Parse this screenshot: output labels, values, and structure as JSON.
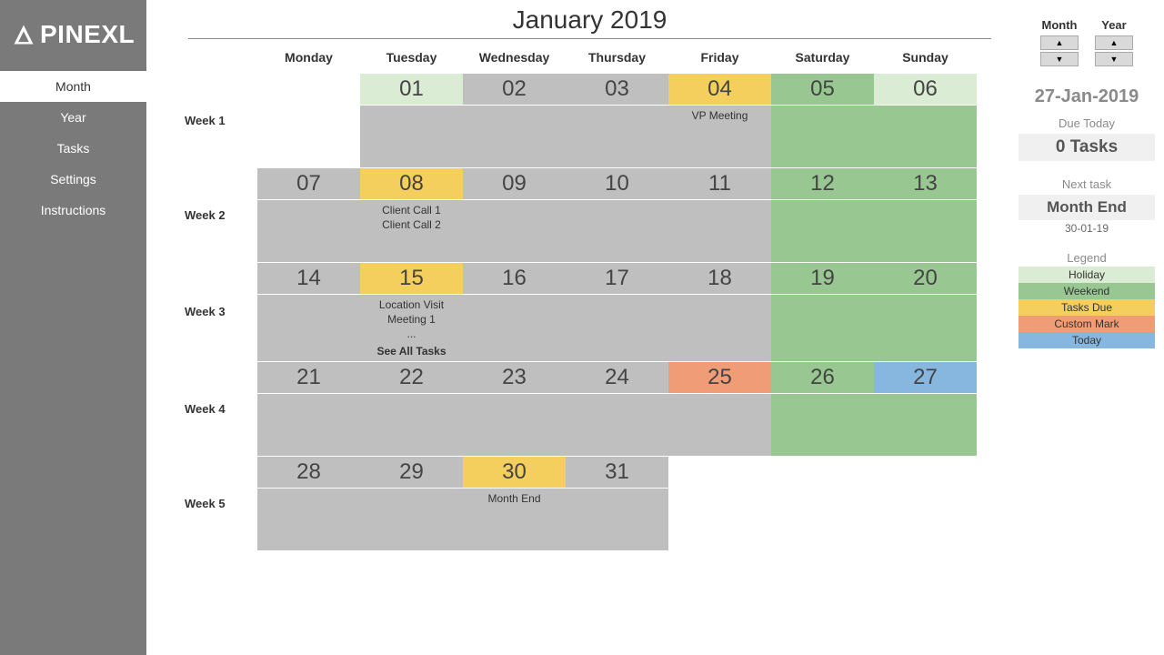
{
  "brand": "PINEXL",
  "nav": {
    "items": [
      {
        "label": "Month",
        "active": true
      },
      {
        "label": "Year",
        "active": false
      },
      {
        "label": "Tasks",
        "active": false
      },
      {
        "label": "Settings",
        "active": false
      },
      {
        "label": "Instructions",
        "active": false
      }
    ]
  },
  "calendar": {
    "title": "January 2019",
    "day_headers": [
      "Monday",
      "Tuesday",
      "Wednesday",
      "Thursday",
      "Friday",
      "Saturday",
      "Sunday"
    ],
    "weeks": [
      {
        "label": "Week 1",
        "cells": [
          {
            "n": "",
            "status": "empty",
            "tasks": []
          },
          {
            "n": "01",
            "status": "holiday",
            "tasks": []
          },
          {
            "n": "02",
            "status": "",
            "tasks": []
          },
          {
            "n": "03",
            "status": "",
            "tasks": []
          },
          {
            "n": "04",
            "status": "tasksdue",
            "tasks": [
              "VP Meeting"
            ]
          },
          {
            "n": "05",
            "status": "weekend",
            "tasks": []
          },
          {
            "n": "06",
            "status": "weekend",
            "tasks": [],
            "num_bg": "holiday"
          }
        ]
      },
      {
        "label": "Week 2",
        "cells": [
          {
            "n": "07",
            "status": "",
            "tasks": []
          },
          {
            "n": "08",
            "status": "tasksdue",
            "tasks": [
              "Client Call 1",
              "Client Call 2"
            ]
          },
          {
            "n": "09",
            "status": "",
            "tasks": []
          },
          {
            "n": "10",
            "status": "",
            "tasks": []
          },
          {
            "n": "11",
            "status": "",
            "tasks": []
          },
          {
            "n": "12",
            "status": "weekend",
            "tasks": []
          },
          {
            "n": "13",
            "status": "weekend",
            "tasks": []
          }
        ]
      },
      {
        "label": "Week 3",
        "cells": [
          {
            "n": "14",
            "status": "",
            "tasks": []
          },
          {
            "n": "15",
            "status": "tasksdue",
            "tasks": [
              "Location Visit",
              "Meeting 1",
              "..."
            ],
            "see_all": "See All Tasks"
          },
          {
            "n": "16",
            "status": "",
            "tasks": []
          },
          {
            "n": "17",
            "status": "",
            "tasks": []
          },
          {
            "n": "18",
            "status": "",
            "tasks": []
          },
          {
            "n": "19",
            "status": "weekend",
            "tasks": []
          },
          {
            "n": "20",
            "status": "weekend",
            "tasks": []
          }
        ]
      },
      {
        "label": "Week 4",
        "cells": [
          {
            "n": "21",
            "status": "",
            "tasks": []
          },
          {
            "n": "22",
            "status": "",
            "tasks": []
          },
          {
            "n": "23",
            "status": "",
            "tasks": []
          },
          {
            "n": "24",
            "status": "",
            "tasks": []
          },
          {
            "n": "25",
            "status": "custom",
            "tasks": []
          },
          {
            "n": "26",
            "status": "weekend",
            "tasks": []
          },
          {
            "n": "27",
            "status": "today",
            "tasks": []
          }
        ]
      },
      {
        "label": "Week 5",
        "cells": [
          {
            "n": "28",
            "status": "",
            "tasks": []
          },
          {
            "n": "29",
            "status": "",
            "tasks": []
          },
          {
            "n": "30",
            "status": "tasksdue",
            "tasks": [
              "Month End"
            ]
          },
          {
            "n": "31",
            "status": "",
            "tasks": []
          },
          {
            "n": "",
            "status": "empty",
            "tasks": []
          },
          {
            "n": "",
            "status": "empty",
            "tasks": []
          },
          {
            "n": "",
            "status": "empty",
            "tasks": []
          }
        ]
      }
    ]
  },
  "spinners": {
    "month_label": "Month",
    "year_label": "Year"
  },
  "side": {
    "today_date": "27-Jan-2019",
    "due_today_label": "Due Today",
    "due_today_value": "0 Tasks",
    "next_task_label": "Next task",
    "next_task_name": "Month End",
    "next_task_date": "30-01-19",
    "legend_title": "Legend",
    "legend": [
      {
        "key": "holiday",
        "label": "Holiday"
      },
      {
        "key": "weekend",
        "label": "Weekend"
      },
      {
        "key": "tasksdue",
        "label": "Tasks Due"
      },
      {
        "key": "custom",
        "label": "Custom Mark"
      },
      {
        "key": "today",
        "label": "Today"
      }
    ]
  },
  "colors": {
    "holiday": "#daecd3",
    "weekend": "#99c792",
    "tasksdue": "#f4cf5d",
    "custom": "#f09d77",
    "today": "#87b7df"
  }
}
